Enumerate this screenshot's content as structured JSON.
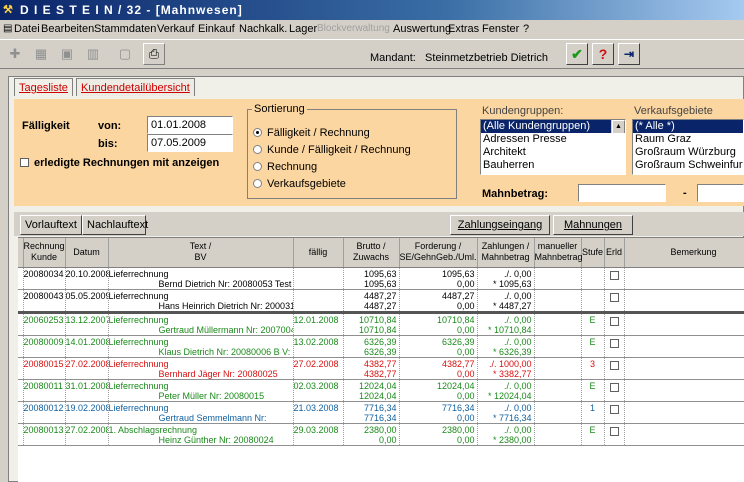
{
  "window": {
    "title": "D I E S T E I N / 32 - [Mahnwesen]"
  },
  "menu": [
    "Datei",
    "Bearbeiten",
    "Stammdaten",
    "Verkauf",
    "Einkauf",
    "Nachkalk.",
    "Lager",
    "Blockverwaltung",
    "Auswertung",
    "Extras",
    "Fenster",
    "?"
  ],
  "mandant": {
    "label": "Mandant:",
    "value": "Steinmetzbetrieb Dietrich"
  },
  "tabs": {
    "tab1": "Tagesliste",
    "tab2": "Kundendetailübersicht"
  },
  "filter": {
    "faelligkeit": "Fälligkeit",
    "von_label": "von:",
    "von": "01.01.2008",
    "bis_label": "bis:",
    "bis": "07.05.2009",
    "erledigte": "erledigte Rechnungen mit anzeigen"
  },
  "sort": {
    "title": "Sortierung",
    "options": [
      "Fälligkeit    / Rechnung",
      "Kunde  /  Fälligkeit  / Rechnung",
      "Rechnung",
      "Verkaufsgebiete"
    ]
  },
  "kundengruppen": {
    "label": "Kundengruppen:",
    "items": [
      "(Alle Kundengruppen)",
      "Adressen Presse",
      "Architekt",
      "Bauherren"
    ]
  },
  "verkaufsgebiete": {
    "label": "Verkaufsgebiete",
    "items": [
      "(* Alle *)",
      "Raum Graz",
      "Großraum Würzburg",
      "Großraum Schweinfurt"
    ]
  },
  "mahnbetrag": {
    "label": "Mahnbetrag:",
    "dash": "-"
  },
  "buttons": {
    "vorlauf": "Vorlauftext",
    "nachlauf": "Nachlauftext",
    "zahlung": "Zahlungseingang",
    "mahnungen": "Mahnungen"
  },
  "columns": {
    "c1": [
      "Rechnung",
      "Kunde"
    ],
    "c2": "Datum",
    "c3": [
      "Text /",
      "BV"
    ],
    "c4": "fällig",
    "c5": [
      "Brutto /",
      "Zuwachs"
    ],
    "c6": [
      "Forderung /",
      "SE/GehnGeb./Uml."
    ],
    "c7": [
      "Zahlungen /",
      "Mahnbetrag"
    ],
    "c8": [
      "manueller",
      "Mahnbetrag"
    ],
    "c9": "Stufe",
    "c10": "Erld",
    "c11": "Bemerkung"
  },
  "rows": [
    {
      "nr": "20080034",
      "datum": "20.10.2008",
      "text1": "Lieferrechnung",
      "text2": "Bernd Dietrich Nr: 20080053 Test",
      "faellig": "",
      "b1": "1095,63",
      "b2": "1095,63",
      "f1": "1095,63",
      "f2": "0,00",
      "z1": "./. 0,00",
      "z2": "* 1095,63",
      "stufe": "",
      "cls": ""
    },
    {
      "nr": "20080043",
      "datum": "05.05.2009",
      "text1": "Lieferrechnung",
      "text2": "Hans Heinrich Dietrich Nr: 2000319",
      "faellig": "",
      "b1": "4487,27",
      "b2": "4487,27",
      "f1": "4487,27",
      "f2": "0,00",
      "z1": "./. 0,00",
      "z2": "* 4487,27",
      "stufe": "",
      "cls": ""
    },
    {
      "nr": "20060253",
      "datum": "13.12.2007",
      "text1": "Lieferrechnung",
      "text2": "Gertraud Müllermann Nr: 20070047",
      "faellig": "12.01.2008",
      "b1": "10710,84",
      "b2": "10710,84",
      "f1": "10710,84",
      "f2": "0,00",
      "z1": "./. 0,00",
      "z2": "* 10710,84",
      "stufe": "E",
      "cls": "g"
    },
    {
      "nr": "20080009",
      "datum": "14.01.2008",
      "text1": "Lieferrechnung",
      "text2": "Klaus Dietrich Nr: 20080006 B V:",
      "faellig": "13.02.2008",
      "b1": "6326,39",
      "b2": "6326,39",
      "f1": "6326,39",
      "f2": "0,00",
      "z1": "./. 0,00",
      "z2": "* 6326,39",
      "stufe": "E",
      "cls": "g"
    },
    {
      "nr": "20080015",
      "datum": "27.02.2008",
      "text1": "Lieferrechnung",
      "text2": "Bernhard Jäger Nr: 20080025",
      "faellig": "27.02.2008",
      "b1": "4382,77",
      "b2": "4382,77",
      "f1": "4382,77",
      "f2": "0,00",
      "z1": "./. 1000,00",
      "z2": "* 3382,77",
      "stufe": "3",
      "cls": "red"
    },
    {
      "nr": "20080011",
      "datum": "31.01.2008",
      "text1": "Lieferrechnung",
      "text2": "Peter Müller Nr: 20080015",
      "faellig": "02.03.2008",
      "b1": "12024,04",
      "b2": "12024,04",
      "f1": "12024,04",
      "f2": "0,00",
      "z1": "./. 0,00",
      "z2": "* 12024,04",
      "stufe": "E",
      "cls": "g"
    },
    {
      "nr": "20080012",
      "datum": "19.02.2008",
      "text1": "Lieferrechnung",
      "text2": "Gertraud Semmelmann Nr:",
      "faellig": "21.03.2008",
      "b1": "7716,34",
      "b2": "7716,34",
      "f1": "7716,34",
      "f2": "0,00",
      "z1": "./. 0,00",
      "z2": "* 7716,34",
      "stufe": "1",
      "cls": "b"
    },
    {
      "nr": "20080013",
      "datum": "27.02.2008",
      "text1": "1. Abschlagsrechnung",
      "text2": "Heinz Günther Nr: 20080024",
      "faellig": "29.03.2008",
      "b1": "2380,00",
      "b2": "0,00",
      "f1": "2380,00",
      "f2": "0,00",
      "z1": "./. 0,00",
      "z2": "* 2380,00",
      "stufe": "E",
      "cls": "g"
    }
  ]
}
